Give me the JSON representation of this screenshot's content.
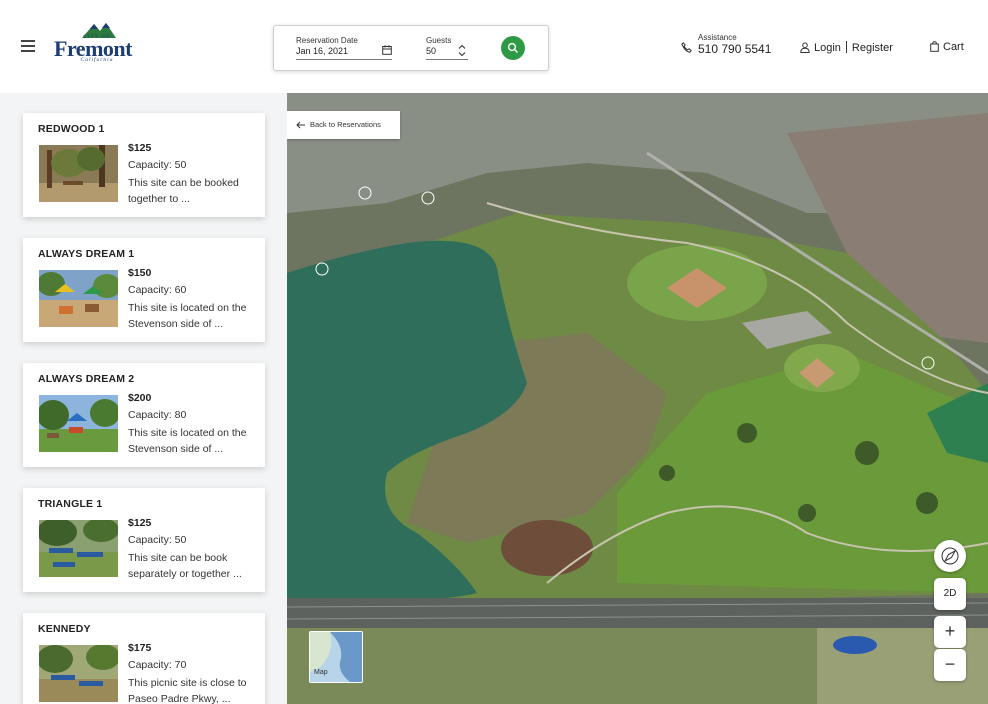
{
  "header": {
    "logo": {
      "city_of": "CITY OF",
      "name": "Fremont",
      "state": "California"
    },
    "reservation": {
      "date_label": "Reservation Date",
      "date_value": "Jan 16, 2021",
      "guests_label": "Guests",
      "guests_value": "50"
    },
    "assistance": {
      "label": "Assistance",
      "phone": "510 790 5541"
    },
    "login_label": "Login",
    "register_label": "Register",
    "cart_label": "Cart"
  },
  "sites": [
    {
      "name": "REDWOOD 1",
      "price": "$125",
      "capacity": "Capacity: 50",
      "description": "This site can be booked together to ..."
    },
    {
      "name": "ALWAYS DREAM 1",
      "price": "$150",
      "capacity": "Capacity: 60",
      "description": "This site is located on the Stevenson side of ..."
    },
    {
      "name": "ALWAYS DREAM 2",
      "price": "$200",
      "capacity": "Capacity: 80",
      "description": "This site is located on the Stevenson side of ..."
    },
    {
      "name": "TRIANGLE 1",
      "price": "$125",
      "capacity": "Capacity: 50",
      "description": "This site can be book separately or together ..."
    },
    {
      "name": "KENNEDY",
      "price": "$175",
      "capacity": "Capacity: 70",
      "description": "This picnic site is close to Paseo Padre Pkwy, ..."
    }
  ],
  "map": {
    "back_label": "Back to Reservations",
    "mode_label": "2D",
    "zoom_in_label": "+",
    "zoom_out_label": "−",
    "minimap_label": "Map"
  },
  "colors": {
    "accent_green": "#2f9a45",
    "brand_blue": "#1e3e73",
    "lake": "#2e6e5a"
  }
}
